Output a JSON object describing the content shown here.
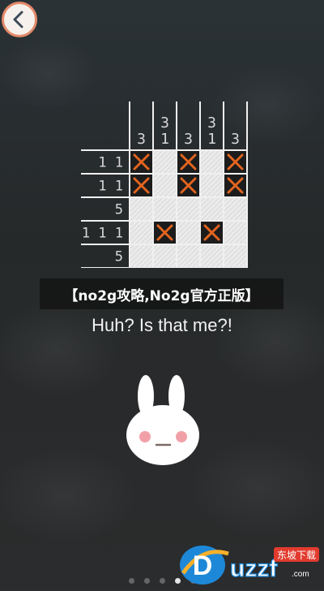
{
  "banner": {
    "text": "【no2g攻略,No2g官方正版】"
  },
  "caption": {
    "text": "Huh? Is that me?!"
  },
  "puzzle": {
    "column_clues": [
      "3",
      "3\n1",
      "3",
      "3\n1",
      "3"
    ],
    "row_clues": [
      "1 1",
      "1 1",
      "5",
      "1 1 1",
      "5"
    ],
    "cells": [
      [
        "x",
        "w",
        "x",
        "w",
        "x"
      ],
      [
        "x",
        "w",
        "x",
        "w",
        "x"
      ],
      [
        "w",
        "w",
        "w",
        "w",
        "w"
      ],
      [
        "w",
        "x",
        "w",
        "x",
        "w"
      ],
      [
        "w",
        "w",
        "w",
        "w",
        "w"
      ]
    ]
  },
  "pager": {
    "count": 5,
    "active_index": 3
  },
  "watermark": {
    "site": "uzzf.com",
    "label": "东坡下载"
  },
  "colors": {
    "accent": "#e2641f",
    "back_border": "#e48a6a",
    "bunny_cheek": "#f2a0a8"
  },
  "icons": {
    "back": "chevron-left-icon",
    "bunny": "bunny-character"
  }
}
